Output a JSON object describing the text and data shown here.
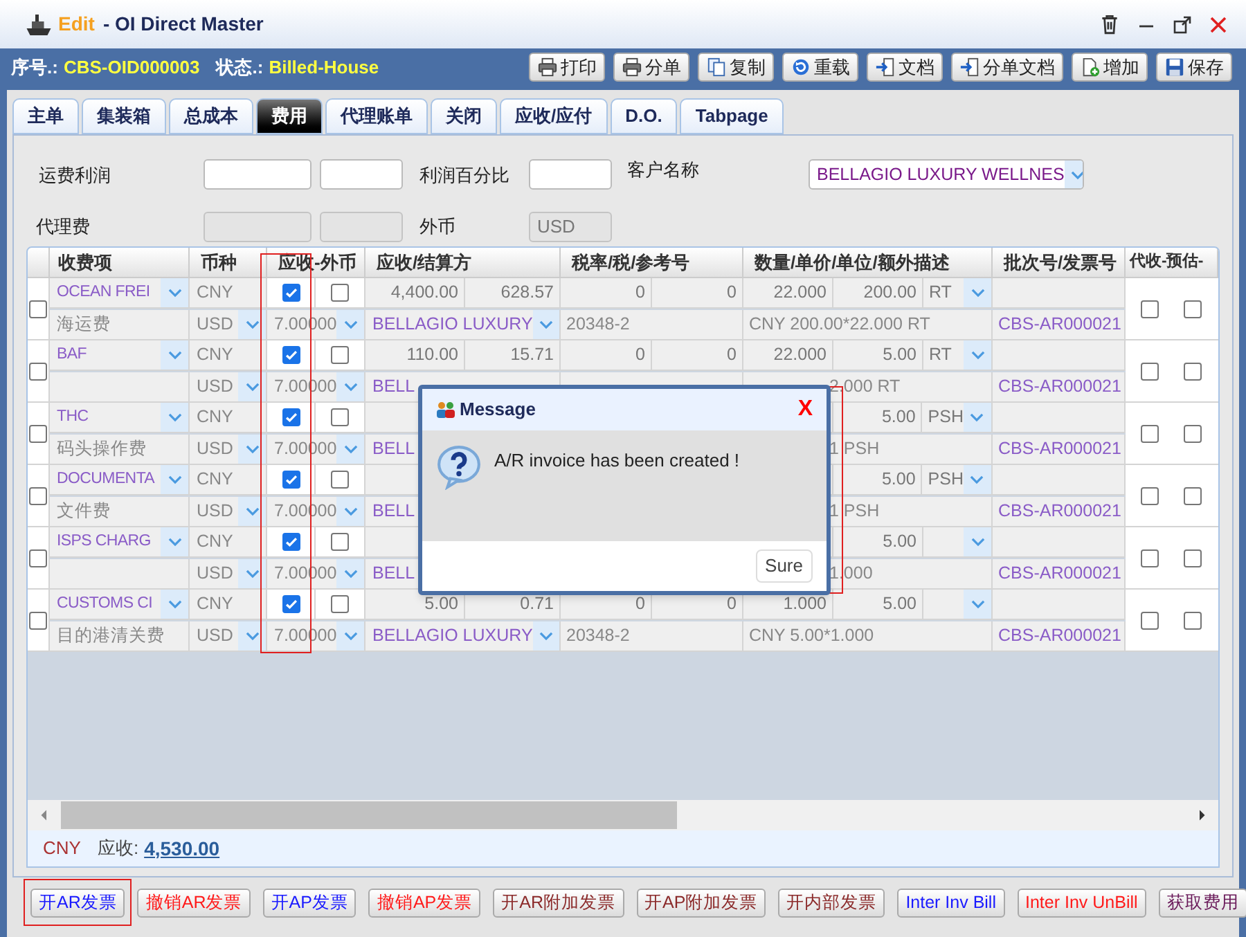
{
  "window": {
    "mode": "Edit",
    "title": "- OI Direct Master"
  },
  "record": {
    "number_label": "序号.:",
    "number": "CBS-OID000003",
    "status_label": "状态.:",
    "status": "Billed-House"
  },
  "toolbar": [
    {
      "label": "打印",
      "kind": "printer"
    },
    {
      "label": "分单",
      "kind": "printer"
    },
    {
      "label": "复制",
      "kind": "copy"
    },
    {
      "label": "重载",
      "kind": "reload"
    },
    {
      "label": "文档",
      "kind": "import"
    },
    {
      "label": "分单文档",
      "kind": "import"
    },
    {
      "label": "增加",
      "kind": "add"
    },
    {
      "label": "保存",
      "kind": "save"
    }
  ],
  "tabs": [
    {
      "label": "主单",
      "selected": false
    },
    {
      "label": "集装箱",
      "selected": false
    },
    {
      "label": "总成本",
      "selected": false
    },
    {
      "label": "费用",
      "selected": true
    },
    {
      "label": "代理账单",
      "selected": false
    },
    {
      "label": "关闭",
      "selected": false
    },
    {
      "label": "应收/应付",
      "selected": false
    },
    {
      "label": "D.O.",
      "selected": false
    },
    {
      "label": "Tabpage",
      "selected": false
    }
  ],
  "form": {
    "freight_profit_label": "运费利润",
    "profit_pct_label": "利润百分比",
    "customer_label": "客户名称",
    "customer": "BELLAGIO LUXURY WELLNES",
    "agency_fee_label": "代理费",
    "agency_fee_disabled": true,
    "foreign_currency_label": "外币",
    "foreign_currency": "USD",
    "foreign_currency_disabled": true
  },
  "table": {
    "columns": [
      {
        "label": "收费项",
        "highlighted": false
      },
      {
        "label": "币种",
        "highlighted": false
      },
      {
        "label": "应收-外币",
        "highlighted": true
      },
      {
        "label": "应收/结算方",
        "highlighted": false
      },
      {
        "label": "税率/税/参考号",
        "highlighted": false
      },
      {
        "label": "数量/单价/单位/额外描述",
        "highlighted": false
      },
      {
        "label": "批次号/发票号",
        "highlighted": false
      },
      {
        "label": "代收-预估-",
        "highlighted": false
      }
    ],
    "rows": [
      {
        "selected": false,
        "code": "OCEAN FREI",
        "currency": "CNY",
        "receivable": true,
        "foreign": false,
        "amount": "4,400.00",
        "amount_2": "628.57",
        "tax": "0",
        "tax_2": "0",
        "qty": "22.000",
        "price": "200.00",
        "unit": "RT",
        "name": "海运费",
        "currency_2": "USD",
        "rate": "7.00000",
        "party": "BELLAGIO LUXURY",
        "party_cut": false,
        "ref": "20348-2",
        "desc": "CNY 200.00*22.000 RT",
        "desc_cut": false,
        "invoice": "CBS-AR000021",
        "collect": false,
        "estimate": false
      },
      {
        "selected": false,
        "code": "BAF",
        "currency": "CNY",
        "receivable": true,
        "foreign": false,
        "amount": "110.00",
        "amount_2": "15.71",
        "tax": "0",
        "tax_2": "0",
        "qty": "22.000",
        "price": "5.00",
        "unit": "RT",
        "currency_2": "USD",
        "rate": "7.00000",
        "party": "BELL",
        "party_cut": true,
        "desc": "2.000 RT",
        "desc_cut": true,
        "invoice": "CBS-AR000021",
        "collect": false,
        "estimate": false
      },
      {
        "selected": false,
        "code": "THC",
        "currency": "CNY",
        "receivable": true,
        "foreign": false,
        "price": "5.00",
        "unit": "PSH",
        "name": "码头操作费",
        "currency_2": "USD",
        "rate": "7.00000",
        "party": "BELL",
        "party_cut": true,
        "desc": "1 PSH",
        "desc_cut": true,
        "invoice": "CBS-AR000021",
        "collect": false,
        "estimate": false
      },
      {
        "selected": false,
        "code": "DOCUMENTA",
        "currency": "CNY",
        "receivable": true,
        "foreign": false,
        "price": "5.00",
        "unit": "PSH",
        "name": "文件费",
        "currency_2": "USD",
        "rate": "7.00000",
        "party": "BELL",
        "party_cut": true,
        "desc": "1 PSH",
        "desc_cut": true,
        "invoice": "CBS-AR000021",
        "collect": false,
        "estimate": false
      },
      {
        "selected": false,
        "code": "ISPS CHARG",
        "currency": "CNY",
        "receivable": true,
        "foreign": false,
        "price": "5.00",
        "currency_2": "USD",
        "rate": "7.00000",
        "party": "BELL",
        "party_cut": true,
        "desc": "1.000",
        "desc_cut": true,
        "invoice": "CBS-AR000021",
        "collect": false,
        "estimate": false
      },
      {
        "selected": false,
        "code": "CUSTOMS CI",
        "currency": "CNY",
        "receivable": true,
        "foreign": false,
        "amount": "5.00",
        "amount_2": "0.71",
        "tax": "0",
        "tax_2": "0",
        "qty": "1.000",
        "price": "5.00",
        "name": "目的港清关费",
        "currency_2": "USD",
        "rate": "7.00000",
        "party": "BELLAGIO LUXURY",
        "party_cut": false,
        "ref": "20348-2",
        "desc": "CNY 5.00*1.000",
        "desc_cut": false,
        "invoice": "CBS-AR000021",
        "collect": false,
        "estimate": false
      }
    ]
  },
  "footer": {
    "currency": "CNY",
    "label": "应收:",
    "total": "4,530.00"
  },
  "buttons": [
    {
      "label": "开AR发票",
      "color": "#1a1aff",
      "highlighted": true
    },
    {
      "label": "撤销AR发票",
      "color": "#ff1a1a",
      "highlighted": false
    },
    {
      "label": "开AP发票",
      "color": "#1a1aff",
      "highlighted": false
    },
    {
      "label": "撤销AP发票",
      "color": "#ff1a1a",
      "highlighted": false
    },
    {
      "label": "开AR附加发票",
      "color": "#8b2a2a",
      "highlighted": false
    },
    {
      "label": "开AP附加发票",
      "color": "#8b2a2a",
      "highlighted": false
    },
    {
      "label": "开内部发票",
      "color": "#8b2a2a",
      "highlighted": false
    },
    {
      "label": "Inter Inv Bill",
      "color": "#1a1aff",
      "highlighted": false
    },
    {
      "label": "Inter Inv UnBill",
      "color": "#ff1a1a",
      "highlighted": false
    },
    {
      "label": "获取费用",
      "color": "#6a1a5a",
      "highlighted": false
    }
  ],
  "dialog": {
    "title": "Message",
    "close": "X",
    "text": "A/R invoice has been created !",
    "button": "Sure",
    "highlighted": true
  }
}
